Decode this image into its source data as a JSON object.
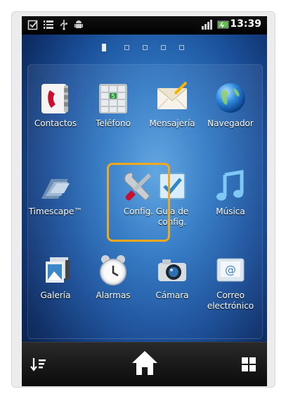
{
  "status": {
    "time": "13:39",
    "left_icons": [
      "checkbox-icon",
      "sim-toolkit-icon",
      "usb-icon",
      "android-debug-icon"
    ],
    "right_icons": [
      "signal-icon",
      "battery-icon"
    ]
  },
  "pager": {
    "count": 5,
    "active_index": 0
  },
  "apps": [
    {
      "label": "Contactos",
      "icon": "contacts-icon"
    },
    {
      "label": "Teléfono",
      "icon": "phone-keypad-icon"
    },
    {
      "label": "Mensajería",
      "icon": "envelope-icon"
    },
    {
      "label": "Navegador",
      "icon": "globe-icon"
    },
    {
      "label": "Timescape™",
      "icon": "timescape-icon"
    },
    {
      "label": "Config.",
      "icon": "wrench-screwdriver-icon"
    },
    {
      "label": "Guía de config.",
      "icon": "checkbox-setup-icon"
    },
    {
      "label": "Música",
      "icon": "music-note-icon"
    },
    {
      "label": "Galería",
      "icon": "gallery-icon"
    },
    {
      "label": "Alarmas",
      "icon": "alarm-clock-icon"
    },
    {
      "label": "Cámara",
      "icon": "camera-icon"
    },
    {
      "label": "Correo electrónico",
      "icon": "email-icon"
    }
  ],
  "highlighted_app": "Config.",
  "dock": {
    "left": "sort-icon",
    "center": "home-icon",
    "right": "app-grid-icon"
  },
  "colors": {
    "highlight": "#f2a81a",
    "wallpaper": "#2f78c4",
    "status_bg": "#000000"
  }
}
